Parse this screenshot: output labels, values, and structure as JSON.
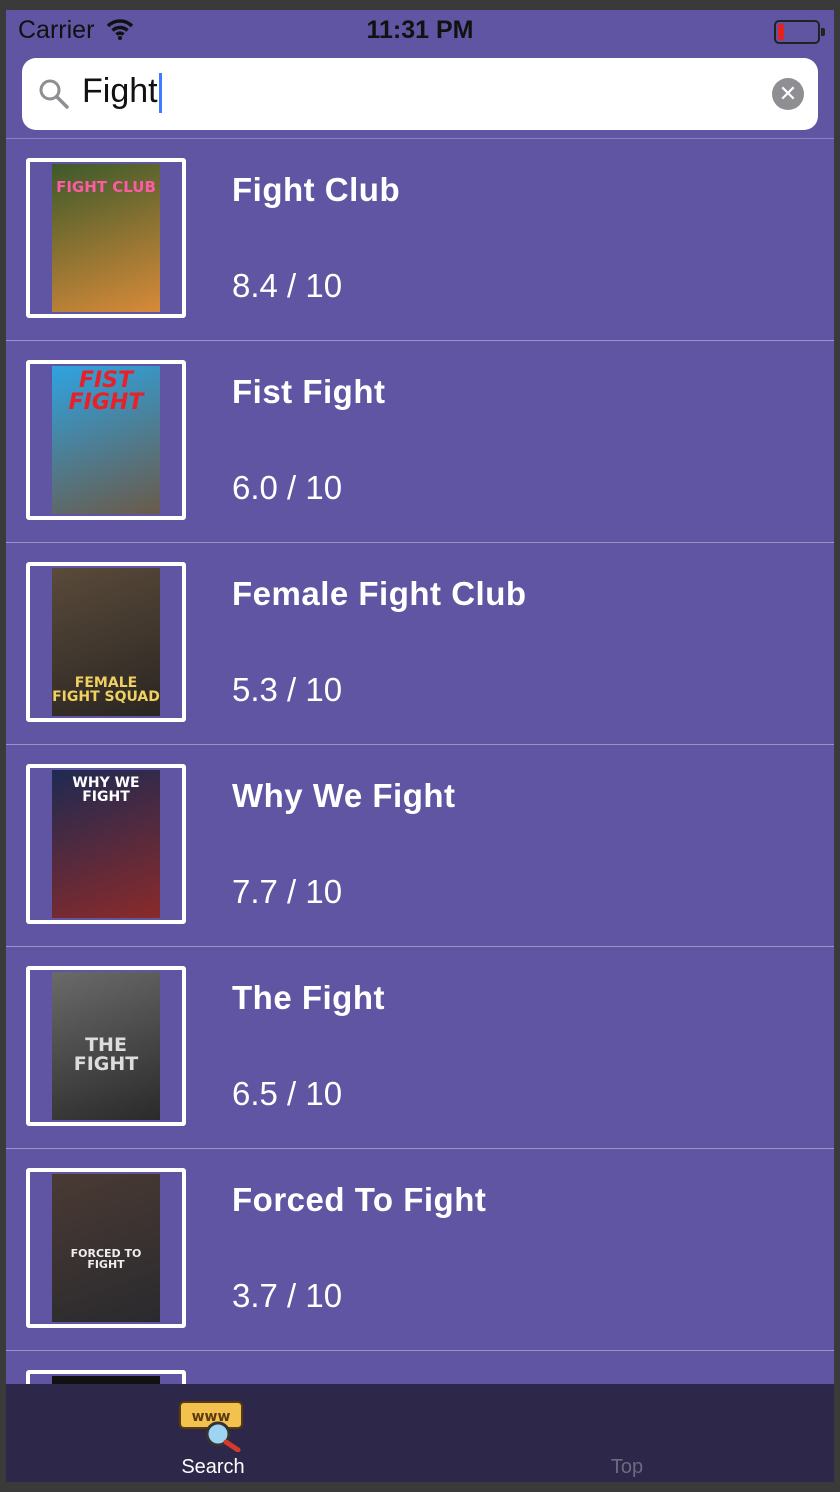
{
  "status_bar": {
    "carrier": "Carrier",
    "time": "11:31 PM"
  },
  "search": {
    "query": "Fight",
    "icon": "search-icon",
    "clear_icon": "clear-icon"
  },
  "results": [
    {
      "title": "Fight Club",
      "rating": "8.4 / 10",
      "poster_text": "FIGHT CLUB",
      "poster_colors": [
        "#3c5a2a",
        "#d88a3a"
      ]
    },
    {
      "title": "Fist Fight",
      "rating": "6.0 / 10",
      "poster_text": "FIST FIGHT",
      "poster_colors": [
        "#2fa3e0",
        "#6a5a4a"
      ]
    },
    {
      "title": "Female Fight Club",
      "rating": "5.3 / 10",
      "poster_text": "FEMALE FIGHT SQUAD",
      "poster_colors": [
        "#5a4a3a",
        "#2a2622"
      ]
    },
    {
      "title": "Why We Fight",
      "rating": "7.7 / 10",
      "poster_text": "WHY WE FIGHT",
      "poster_colors": [
        "#1e2a52",
        "#8a2a2a"
      ]
    },
    {
      "title": "The Fight",
      "rating": "6.5 / 10",
      "poster_text": "THE FIGHT",
      "poster_colors": [
        "#6a6a6a",
        "#2a2a2a"
      ]
    },
    {
      "title": "Forced To Fight",
      "rating": "3.7 / 10",
      "poster_text": "FORCED TO FIGHT",
      "poster_colors": [
        "#4a3a34",
        "#2a2a2e"
      ]
    }
  ],
  "tabs": [
    {
      "label": "Search",
      "icon": "www-search-icon",
      "selected": true
    },
    {
      "label": "Top",
      "icon": "top-icon",
      "selected": false
    }
  ]
}
